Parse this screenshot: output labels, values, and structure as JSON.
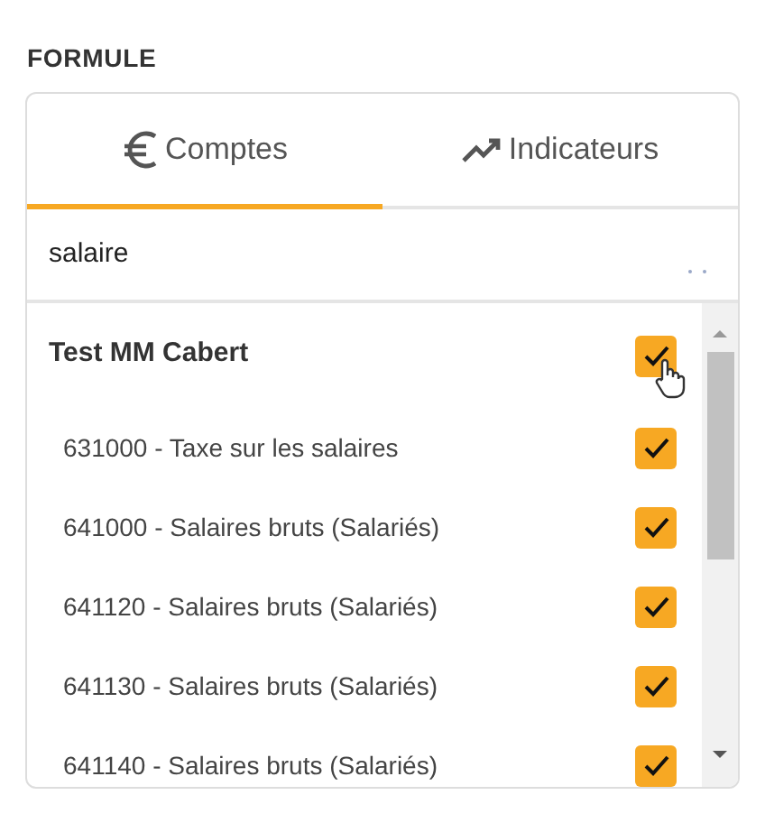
{
  "title": "FORMULE",
  "tabs": [
    {
      "label": "Comptes",
      "selected": true
    },
    {
      "label": "Indicateurs",
      "selected": false
    }
  ],
  "search": {
    "value": "salaire"
  },
  "group": {
    "label": "Test MM Cabert",
    "checked": true
  },
  "items": [
    {
      "label": "631000 - Taxe sur les salaires",
      "checked": true
    },
    {
      "label": "641000 - Salaires bruts (Salariés)",
      "checked": true
    },
    {
      "label": "641120 - Salaires bruts (Salariés)",
      "checked": true
    },
    {
      "label": "641130 - Salaires bruts (Salariés)",
      "checked": true
    },
    {
      "label": "641140 - Salaires bruts (Salariés)",
      "checked": true
    }
  ]
}
